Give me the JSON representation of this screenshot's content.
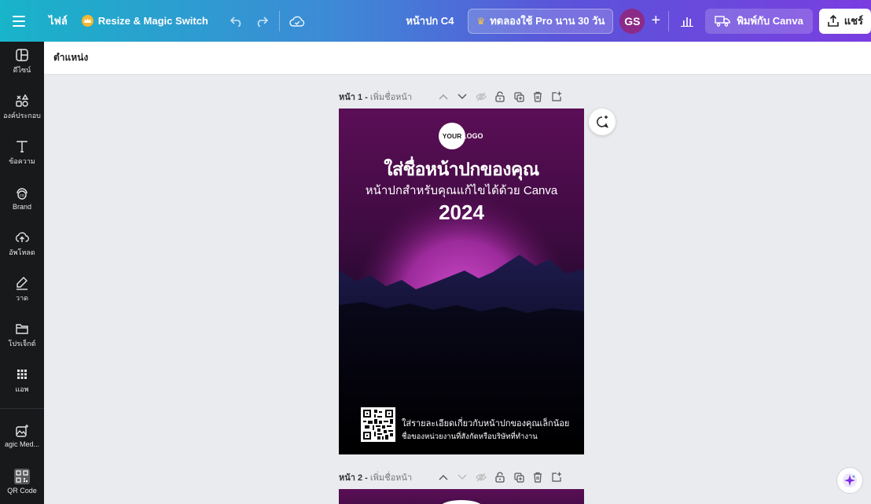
{
  "topbar": {
    "file_label": "ไฟล์",
    "resize_label": "Resize & Magic Switch",
    "doc_title": "หน้าปก C4",
    "trial_label": "ทดลองใช้ Pro นาน 30 วัน",
    "avatar_initials": "GS",
    "plus_label": "+",
    "print_label": "พิมพ์กับ Canva",
    "share_label": "แชร์"
  },
  "sidebar": {
    "items": [
      {
        "label": "ดีไซน์",
        "icon": "layout-icon"
      },
      {
        "label": "องค์ประกอบ",
        "icon": "shapes-icon"
      },
      {
        "label": "ข้อความ",
        "icon": "text-icon"
      },
      {
        "label": "Brand",
        "icon": "brand-icon"
      },
      {
        "label": "อัพโหลด",
        "icon": "upload-icon"
      },
      {
        "label": "วาด",
        "icon": "draw-icon"
      },
      {
        "label": "โปรเจ็กต์",
        "icon": "folder-icon"
      },
      {
        "label": "แอพ",
        "icon": "apps-icon"
      },
      {
        "label": "agic Med...",
        "icon": "magic-media-icon"
      },
      {
        "label": "QR Code",
        "icon": "qr-code-icon"
      }
    ]
  },
  "subbar": {
    "position_label": "ตำแหน่ง"
  },
  "pages": [
    {
      "name": "หน้า 1 -",
      "add_title": "เพิ่มชื่อหน้า"
    },
    {
      "name": "หน้า 2 -",
      "add_title": "เพิ่มชื่อหน้า"
    }
  ],
  "design": {
    "logo_circle": "YOUR",
    "logo_text": "LOGO",
    "title": "ใส่ชื่อหน้าปกของคุณ",
    "subtitle": "หน้าปกสำหรับคุณแก้ไขได้ด้วย Canva",
    "year": "2024",
    "detail_line1": "ใส่รายละเอียดเกี่ยวกับหน้าปกของคุณเล็กน้อย",
    "detail_line2": "ชื่อของหน่วยงานที่สังกัดหรือบริษัทที่ทำงาน"
  },
  "colors": {
    "topbar_start": "#18b4c9",
    "topbar_end": "#7a3ee0",
    "sidebar_bg": "#18191b",
    "design_top": "#5b0e56",
    "design_glow": "#c43fc0",
    "accent_purple": "#7d2ae8"
  }
}
